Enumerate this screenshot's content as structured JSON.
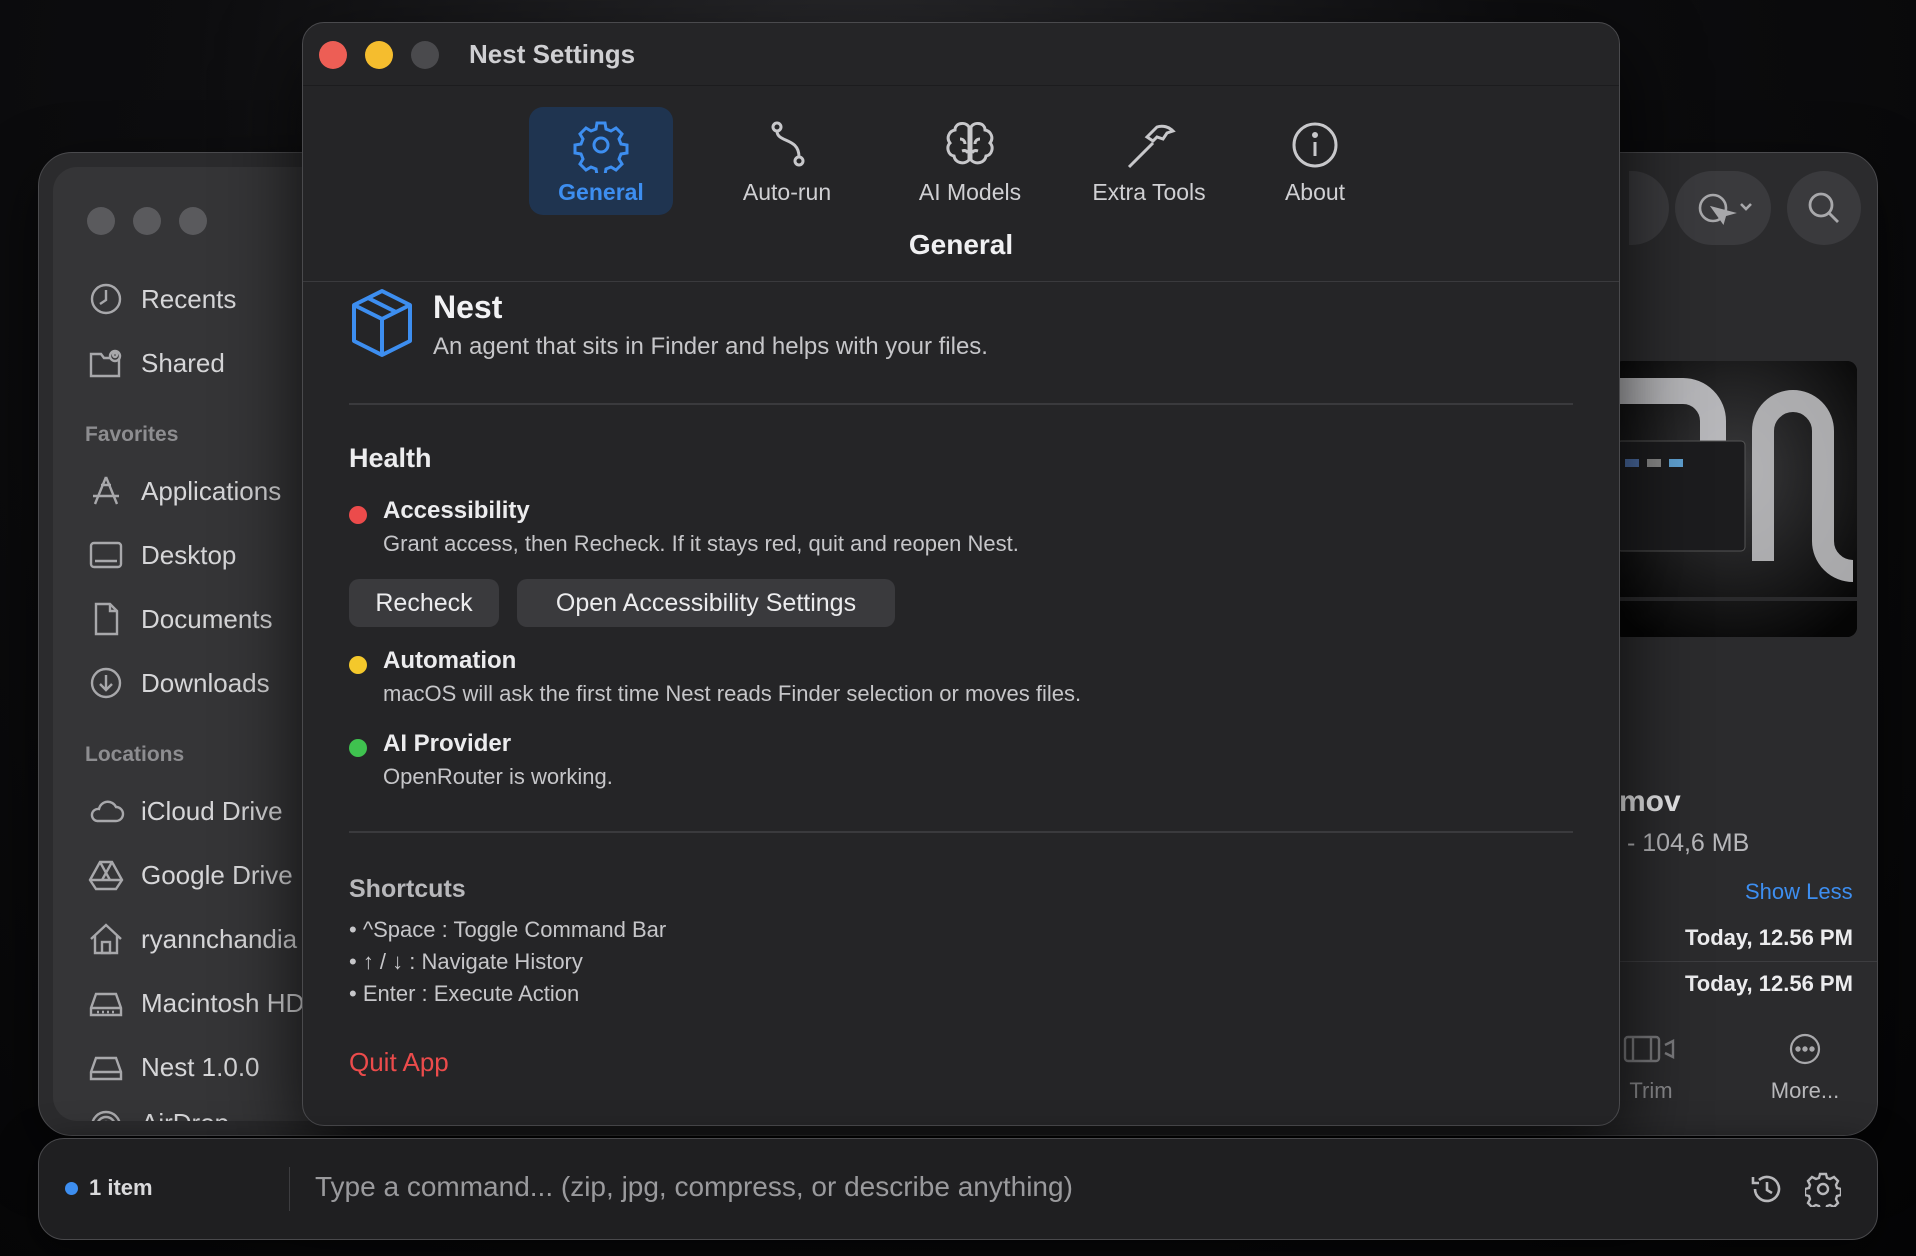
{
  "finder": {
    "sidebar": {
      "items_top": [
        {
          "label": "Recents",
          "icon": "clock-icon"
        },
        {
          "label": "Shared",
          "icon": "shared-folder-icon"
        }
      ],
      "favorites_heading": "Favorites",
      "favorites": [
        {
          "label": "Applications",
          "icon": "applications-icon"
        },
        {
          "label": "Desktop",
          "icon": "desktop-icon"
        },
        {
          "label": "Documents",
          "icon": "document-icon"
        },
        {
          "label": "Downloads",
          "icon": "download-icon"
        }
      ],
      "locations_heading": "Locations",
      "locations": [
        {
          "label": "iCloud Drive",
          "icon": "cloud-icon"
        },
        {
          "label": "Google Drive",
          "icon": "google-drive-icon"
        },
        {
          "label": "ryannchandia",
          "icon": "home-icon"
        },
        {
          "label": "Macintosh HD",
          "icon": "disk-icon"
        },
        {
          "label": "Nest 1.0.0",
          "icon": "disk-icon"
        },
        {
          "label": "AirDrop",
          "icon": "airdrop-icon"
        }
      ]
    },
    "inspector": {
      "file_name_partial": "mov",
      "file_meta_partial": "- 104,6 MB",
      "show_less": "Show Less",
      "date_1": "Today, 12.56 PM",
      "date_2": "Today, 12.56 PM",
      "trim_label": "Trim",
      "more_label": "More..."
    }
  },
  "settings": {
    "window_title": "Nest Settings",
    "tabs": [
      {
        "label": "General",
        "icon": "gear-icon",
        "active": true
      },
      {
        "label": "Auto-run",
        "icon": "path-icon",
        "active": false
      },
      {
        "label": "AI Models",
        "icon": "brain-icon",
        "active": false
      },
      {
        "label": "Extra Tools",
        "icon": "hammer-icon",
        "active": false
      },
      {
        "label": "About",
        "icon": "info-icon",
        "active": false
      }
    ],
    "section_title": "General",
    "app": {
      "name": "Nest",
      "tagline": "An agent that sits in Finder and helps with your files."
    },
    "health": {
      "heading": "Health",
      "items": [
        {
          "title": "Accessibility",
          "desc": "Grant access, then Recheck. If it stays red, quit and reopen Nest.",
          "status_color": "#ec4b4b"
        },
        {
          "title": "Automation",
          "desc": "macOS will ask the first time Nest reads Finder selection or moves files.",
          "status_color": "#f4c82b"
        },
        {
          "title": "AI Provider",
          "desc": "OpenRouter is working.",
          "status_color": "#3fc24f"
        }
      ],
      "recheck_label": "Recheck",
      "open_settings_label": "Open Accessibility Settings"
    },
    "shortcuts": {
      "heading": "Shortcuts",
      "lines": [
        "• ^Space : Toggle Command Bar",
        "• ↑ / ↓ : Navigate History",
        "• Enter : Execute Action"
      ]
    },
    "quit_label": "Quit App"
  },
  "command_bar": {
    "selection_count": "1 item",
    "placeholder": "Type a command... (zip, jpg, compress, or describe anything)"
  },
  "colors": {
    "accent": "#3d8ef0",
    "danger": "#ec4b4b",
    "traffic_close": "#ed5e55",
    "traffic_min": "#f5bd2e"
  }
}
